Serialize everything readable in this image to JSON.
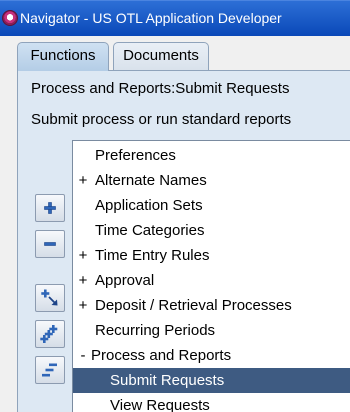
{
  "window": {
    "title": "Navigator - US OTL Application Developer",
    "icon": "oracle-app-icon"
  },
  "tabs": [
    {
      "label": "Functions",
      "active": true
    },
    {
      "label": "Documents",
      "active": false
    }
  ],
  "function": {
    "path": "Process and Reports:Submit Requests",
    "description": "Submit process or run standard reports"
  },
  "side_buttons": [
    {
      "name": "expand-icon"
    },
    {
      "name": "collapse-icon"
    },
    {
      "name": "expand-branch-icon"
    },
    {
      "name": "expand-all-icon"
    },
    {
      "name": "collapse-all-icon"
    }
  ],
  "tree": {
    "items": [
      {
        "prefix": "",
        "label": "Preferences"
      },
      {
        "prefix": "+",
        "label": "Alternate Names"
      },
      {
        "prefix": "",
        "label": "Application Sets"
      },
      {
        "prefix": "",
        "label": "Time Categories"
      },
      {
        "prefix": "+",
        "label": "Time Entry Rules"
      },
      {
        "prefix": "+",
        "label": "Approval"
      },
      {
        "prefix": "+",
        "label": "Deposit / Retrieval Processes"
      },
      {
        "prefix": "",
        "label": "Recurring Periods"
      },
      {
        "prefix": "-",
        "label": "Process and Reports"
      },
      {
        "prefix": "",
        "label": "Submit Requests",
        "selected": true
      },
      {
        "prefix": "",
        "label": "View Requests"
      }
    ]
  },
  "colors": {
    "title_bar": "#0a48b8",
    "selection": "#3e5b82",
    "panel": "#dde8f3"
  }
}
